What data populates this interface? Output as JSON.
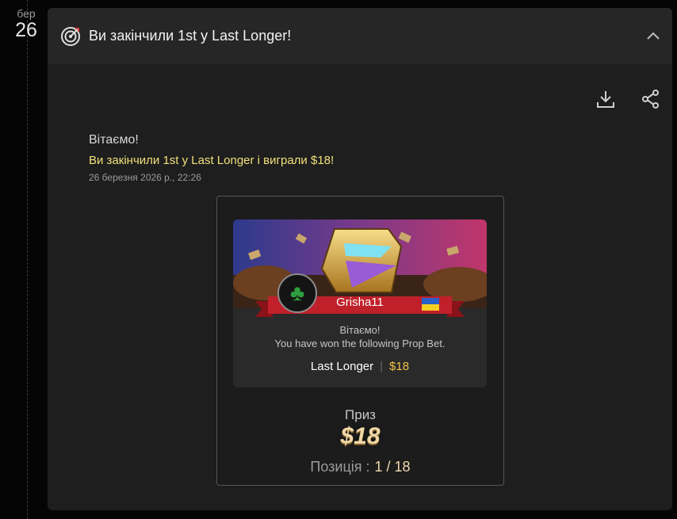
{
  "timeline": {
    "month": "бер",
    "day": "26"
  },
  "header": {
    "title": "Ви закінчили 1st у Last Longer!",
    "icon": "target-icon"
  },
  "toolbar": {
    "download_icon": "download-icon",
    "share_icon": "share-icon"
  },
  "message": {
    "greeting": "Вітаємо!",
    "text": "Ви закінчили 1st у Last Longer і виграли $18!",
    "timestamp": "26 березня 2026 р., 22:26"
  },
  "win_card": {
    "username": "Grisha11",
    "greeting": "Вітаємо!",
    "subtitle": "You have won the following Prop Bet.",
    "bet_name": "Last Longer",
    "separator": "|",
    "bet_amount": "$18"
  },
  "prize": {
    "label": "Приз",
    "amount": "$18"
  },
  "position": {
    "label": "Позиція :",
    "value": "1 / 18"
  },
  "colors": {
    "accent_text": "#f1e07a",
    "bet_amount": "#f0c24b",
    "ribbon": "#c0202a",
    "card_bg": "#1e1e1e"
  }
}
